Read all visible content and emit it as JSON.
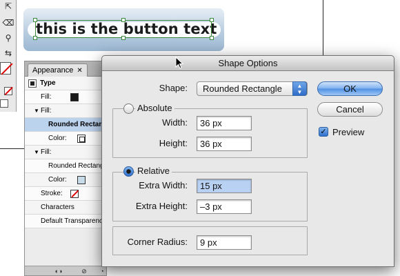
{
  "canvas": {
    "button_text": "this is the button text"
  },
  "appearance_panel": {
    "tab_label": "Appearance",
    "tab_close": "✕",
    "rows": [
      {
        "label": "Type"
      },
      {
        "label": "Fill:",
        "swatch": "black"
      },
      {
        "label": "Fill:",
        "expander": "▼"
      },
      {
        "label": "Rounded Rectang",
        "selected": true
      },
      {
        "label": "Color:",
        "swatch": "framed"
      },
      {
        "label": "Fill:",
        "expander": "▼"
      },
      {
        "label": "Rounded Rectangl"
      },
      {
        "label": "Color:",
        "swatch": "lightblue"
      },
      {
        "label": "Stroke:",
        "swatch": "none"
      },
      {
        "label": "Characters"
      },
      {
        "label": "Default Transparency"
      }
    ]
  },
  "dialog": {
    "title": "Shape Options",
    "shape_label": "Shape:",
    "shape_value": "Rounded Rectangle",
    "absolute_label": "Absolute",
    "width_label": "Width:",
    "width_value": "36 px",
    "height_label": "Height:",
    "height_value": "36 px",
    "relative_label": "Relative",
    "relative_selected": true,
    "extra_width_label": "Extra Width:",
    "extra_width_value": "15 px",
    "extra_height_label": "Extra Height:",
    "extra_height_value": "–3 px",
    "corner_radius_label": "Corner Radius:",
    "corner_radius_value": "9 px",
    "ok_label": "OK",
    "cancel_label": "Cancel",
    "preview_label": "Preview",
    "preview_checked": true
  },
  "colors": {
    "selection": "#3b8a3b",
    "highlight": "#b9d1f3",
    "accent": "#2f6fcd"
  }
}
